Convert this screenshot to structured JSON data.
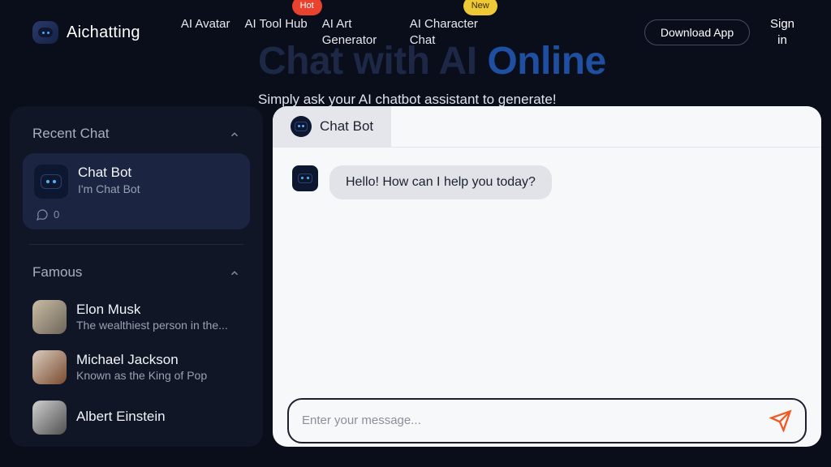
{
  "brand": {
    "name": "Aichatting"
  },
  "nav": {
    "items": [
      {
        "label": "AI Avatar",
        "badge": null
      },
      {
        "label": "AI Tool Hub",
        "badge": {
          "text": "Hot",
          "kind": "hot"
        }
      },
      {
        "label": "AI Art Generator",
        "badge": null
      },
      {
        "label": "AI Character Chat",
        "badge": {
          "text": "New",
          "kind": "new"
        }
      }
    ],
    "download": "Download App",
    "signin": "Sign in"
  },
  "hero": {
    "title_prefix": "Chat with AI ",
    "title_accent": "Online",
    "subtitle": "Simply ask your AI chatbot assistant to generate!"
  },
  "sidebar": {
    "recent": {
      "heading": "Recent Chat",
      "card": {
        "title": "Chat Bot",
        "subtitle": "I'm Chat Bot",
        "count": "0"
      }
    },
    "famous": {
      "heading": "Famous",
      "people": [
        {
          "name": "Elon Musk",
          "desc": "The wealthiest person in the...",
          "avatar_class": "musk"
        },
        {
          "name": "Michael Jackson",
          "desc": "Known as the King of Pop",
          "avatar_class": "mj"
        },
        {
          "name": "Albert Einstein",
          "desc": "",
          "avatar_class": "einstein"
        }
      ]
    }
  },
  "chat": {
    "tab_label": "Chat Bot",
    "messages": [
      {
        "from": "bot",
        "text": "Hello! How can I help you today?"
      }
    ],
    "composer_placeholder": "Enter your message..."
  },
  "icons": {
    "chevron_up": "chevron-up-icon",
    "chat_bubble": "chat-bubble-icon",
    "send": "send-icon",
    "bot": "bot-icon"
  },
  "colors": {
    "bg": "#0a0e1a",
    "panel": "#101626",
    "accent": "#1f4fa0",
    "send": "#f15a24"
  }
}
